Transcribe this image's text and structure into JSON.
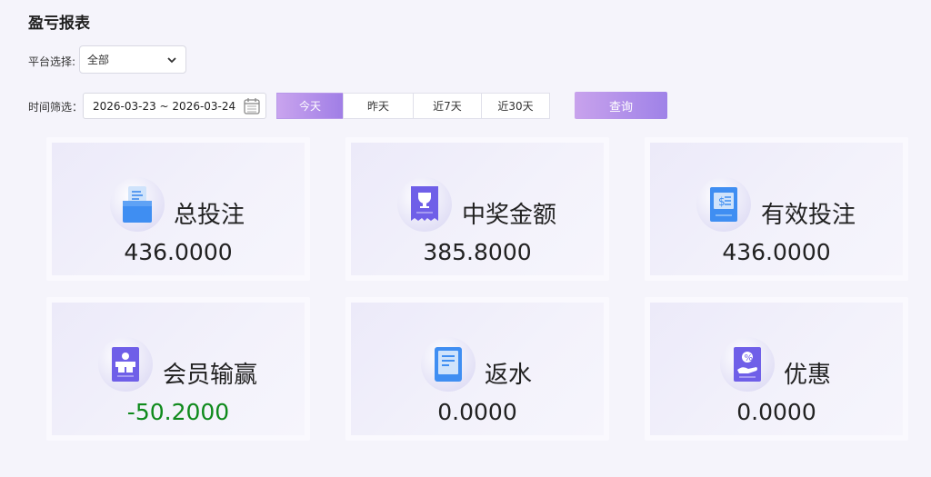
{
  "title": "盈亏报表",
  "filters": {
    "platform_label": "平台选择:",
    "platform_value": "全部",
    "time_label": "时间筛选：",
    "date_range": "2026-03-23 ~ 2026-03-24",
    "quick_ranges": [
      "今天",
      "昨天",
      "近7天",
      "近30天"
    ],
    "active_range": "今天",
    "query_label": "查询"
  },
  "cards": [
    {
      "label": "总投注",
      "value": "436.0000",
      "icon": "document-tray-icon"
    },
    {
      "label": "中奖金额",
      "value": "385.8000",
      "icon": "trophy-receipt-icon"
    },
    {
      "label": "有效投注",
      "value": "436.0000",
      "icon": "cash-receipt-icon"
    },
    {
      "label": "会员输赢",
      "value": "-50.2000",
      "icon": "member-result-icon"
    },
    {
      "label": "返水",
      "value": "0.0000",
      "icon": "rebate-document-icon"
    },
    {
      "label": "优惠",
      "value": "0.0000",
      "icon": "discount-hand-icon"
    }
  ],
  "colors": {
    "accent": "#a07ee6",
    "negative": "#0f8a1c",
    "icon_blue": "#3f8ef2",
    "icon_purple": "#6f5fe8"
  }
}
